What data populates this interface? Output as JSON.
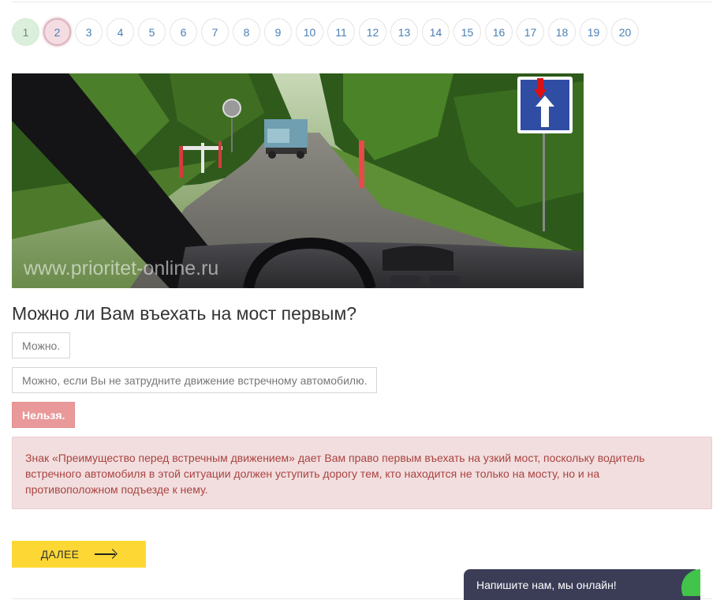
{
  "pagination": {
    "pages": [
      "1",
      "2",
      "3",
      "4",
      "5",
      "6",
      "7",
      "8",
      "9",
      "10",
      "11",
      "12",
      "13",
      "14",
      "15",
      "16",
      "17",
      "18",
      "19",
      "20"
    ],
    "done": [
      "1"
    ],
    "current": "2"
  },
  "image": {
    "watermark": "www.prioritet-online.ru"
  },
  "question": {
    "text": "Можно ли Вам въехать на мост первым?"
  },
  "answers": [
    {
      "label": "Можно.",
      "state": "normal"
    },
    {
      "label": "Можно, если Вы не затрудните движение встречному автомобилю.",
      "state": "normal"
    },
    {
      "label": "Нельзя.",
      "state": "wrong"
    }
  ],
  "explanation": {
    "text": "Знак «Преимущество перед встречным движением» дает Вам право первым въехать на узкий мост, поскольку водитель встречного автомобиля в этой ситуации должен уступить дорогу тем, кто находится не только на мосту, но и на противоположном подъезде к нему."
  },
  "next_button": {
    "label": "ДАЛЕЕ"
  },
  "chat": {
    "label": "Напишите нам, мы онлайн!"
  },
  "colors": {
    "done_page": "#dcefdc",
    "current_page": "#f4dde2",
    "wrong_answer": "#e9999a",
    "explanation_bg": "#f2dede",
    "explanation_text": "#a94442",
    "next_button": "#fdd835",
    "chat_bg": "#3b3d57",
    "chat_dot": "#41c449"
  }
}
